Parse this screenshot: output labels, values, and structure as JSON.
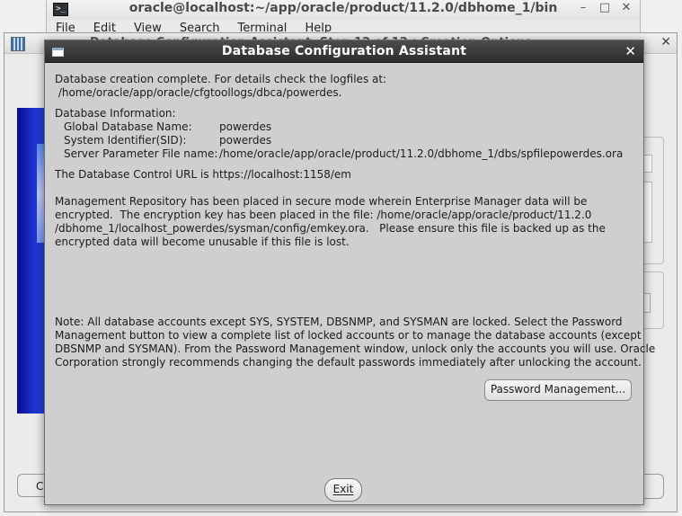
{
  "terminal": {
    "title": "oracle@localhost:~/app/oracle/product/11.2.0/dbhome_1/bin",
    "icon": "terminal-icon",
    "menu": [
      "File",
      "Edit",
      "View",
      "Search",
      "Terminal",
      "Help"
    ],
    "controls": {
      "minimize": "–",
      "maximize": "□",
      "close": "✕"
    }
  },
  "background_window": {
    "close": "✕",
    "icon": "dbca-app-icon",
    "title": "Database Configuration Assistant, Step 12 of 12 : Creation Options",
    "left_button": "C"
  },
  "dialog": {
    "title": "Database Configuration Assistant",
    "close": "✕",
    "completion_line": "Database creation complete. For details check the logfiles at:",
    "log_path": " /home/oracle/app/oracle/cfgtoollogs/dbca/powerdes.",
    "info_heading": "Database Information:",
    "info": [
      {
        "key": "Global Database Name:",
        "value": "powerdes"
      },
      {
        "key": "System Identifier(SID):",
        "value": "powerdes"
      },
      {
        "key": "Server Parameter File name:",
        "value": "/home/oracle/app/oracle/product/11.2.0/dbhome_1/dbs/spfilepowerdes.ora"
      }
    ],
    "control_url": "The Database Control URL is https://localhost:1158/em",
    "repository_lines": [
      "Management Repository has been placed in secure mode wherein Enterprise Manager data will be",
      "encrypted.  The encryption key has been placed in the file: /home/oracle/app/oracle/product/11.2.0",
      "/dbhome_1/localhost_powerdes/sysman/config/emkey.ora.   Please ensure this file is backed up as the",
      "encrypted data will become unusable if this file is lost."
    ],
    "note_lines": [
      "Note: All database accounts except SYS, SYSTEM, DBSNMP, and SYSMAN are locked. Select the Password",
      "Management button to view a complete list of locked accounts or to manage the database accounts (except",
      "DBSNMP and SYSMAN). From the Password Management window, unlock only the accounts you will use. Oracle",
      "Corporation strongly recommends changing the default passwords immediately after unlocking the account."
    ],
    "password_button": "Password Management...",
    "exit_button": "Exit"
  }
}
